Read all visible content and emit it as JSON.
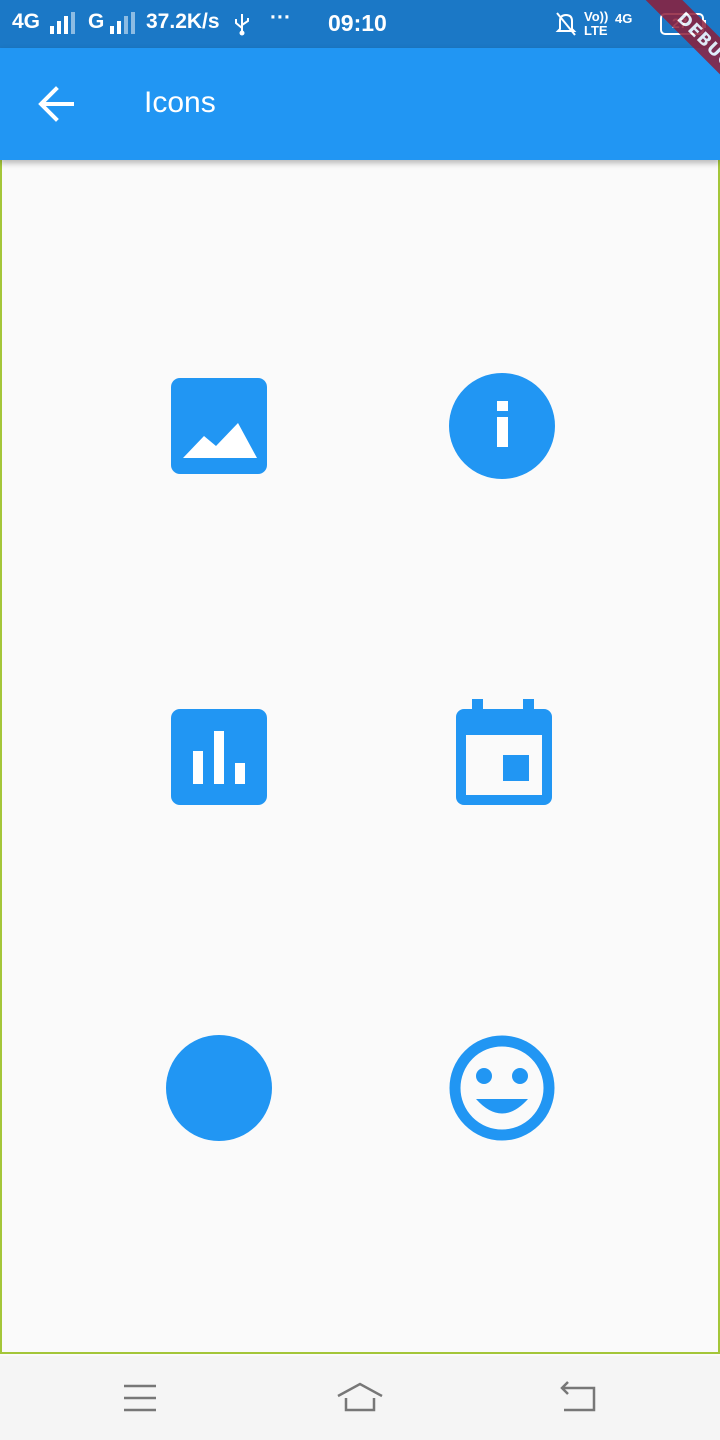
{
  "status_bar": {
    "network1": "4G",
    "network2": "G",
    "speed": "37.2K/s",
    "dots": "···",
    "time": "09:10",
    "volte_top": "Vo))",
    "volte_bottom": "LTE",
    "net_small": "4G",
    "battery": "27"
  },
  "debug_banner": "DEBUG",
  "app_bar": {
    "title": "Icons",
    "back_icon": "arrow-back-icon"
  },
  "icons": [
    {
      "name": "image-icon"
    },
    {
      "name": "info-icon"
    },
    {
      "name": "insert-chart-icon"
    },
    {
      "name": "event-icon"
    },
    {
      "name": "circle-icon"
    },
    {
      "name": "smiley-face-icon"
    }
  ],
  "colors": {
    "accent": "#2196f3",
    "status_bar": "#1b78c6",
    "background": "#fafafa"
  },
  "nav_bar": {
    "items": [
      "menu-icon",
      "home-icon",
      "back-icon"
    ]
  }
}
